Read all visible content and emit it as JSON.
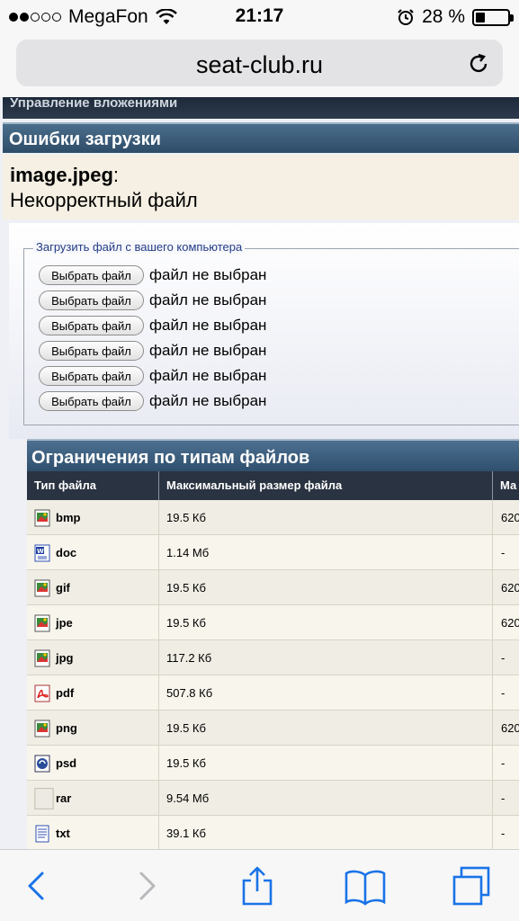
{
  "status_bar": {
    "carrier": "MegaFon",
    "time": "21:17",
    "battery": "28 %",
    "battery_level": 0.28,
    "signal_bars_filled": 2,
    "signal_bars_total": 5
  },
  "address_bar": {
    "url": "seat-club.ru"
  },
  "page": {
    "top_strip": "Управление вложениями",
    "errors_title": "Ошибки загрузки",
    "error_file": "image.jpeg",
    "error_colon": ":",
    "error_message": "Некорректный файл",
    "upload_legend": "Загрузить файл с вашего компьютера",
    "file_inputs": [
      {
        "button": "Выбрать файл",
        "state": "файл не выбран"
      },
      {
        "button": "Выбрать файл",
        "state": "файл не выбран"
      },
      {
        "button": "Выбрать файл",
        "state": "файл не выбран"
      },
      {
        "button": "Выбрать файл",
        "state": "файл не выбран"
      },
      {
        "button": "Выбрать файл",
        "state": "файл не выбран"
      },
      {
        "button": "Выбрать файл",
        "state": "файл не выбран"
      }
    ],
    "limits_title": "Ограничения по типам файлов",
    "columns": [
      "Тип файла",
      "Максимальный размер файла",
      "Ма"
    ],
    "rows": [
      {
        "type": "bmp",
        "size": "19.5 Кб",
        "extra": "620",
        "icon": "image-icon"
      },
      {
        "type": "doc",
        "size": "1.14 Мб",
        "extra": "-",
        "icon": "word-icon"
      },
      {
        "type": "gif",
        "size": "19.5 Кб",
        "extra": "620",
        "icon": "image-icon"
      },
      {
        "type": "jpe",
        "size": "19.5 Кб",
        "extra": "620",
        "icon": "image-icon"
      },
      {
        "type": "jpg",
        "size": "117.2 Кб",
        "extra": "-",
        "icon": "image-icon"
      },
      {
        "type": "pdf",
        "size": "507.8 Кб",
        "extra": "-",
        "icon": "pdf-icon"
      },
      {
        "type": "png",
        "size": "19.5 Кб",
        "extra": "620",
        "icon": "image-icon"
      },
      {
        "type": "psd",
        "size": "19.5 Кб",
        "extra": "-",
        "icon": "psd-icon"
      },
      {
        "type": "rar",
        "size": "9.54 Мб",
        "extra": "-",
        "icon": "blank-icon"
      },
      {
        "type": "txt",
        "size": "39.1 Кб",
        "extra": "-",
        "icon": "text-icon"
      }
    ]
  },
  "toolbar": {
    "back": "back-icon",
    "forward": "forward-icon",
    "share": "share-icon",
    "bookmarks": "bookmarks-icon",
    "tabs": "tabs-icon"
  },
  "colors": {
    "ios_blue": "#1a73e8",
    "header_dark": "#2a3341",
    "title_blue": "#2f4f6d"
  }
}
